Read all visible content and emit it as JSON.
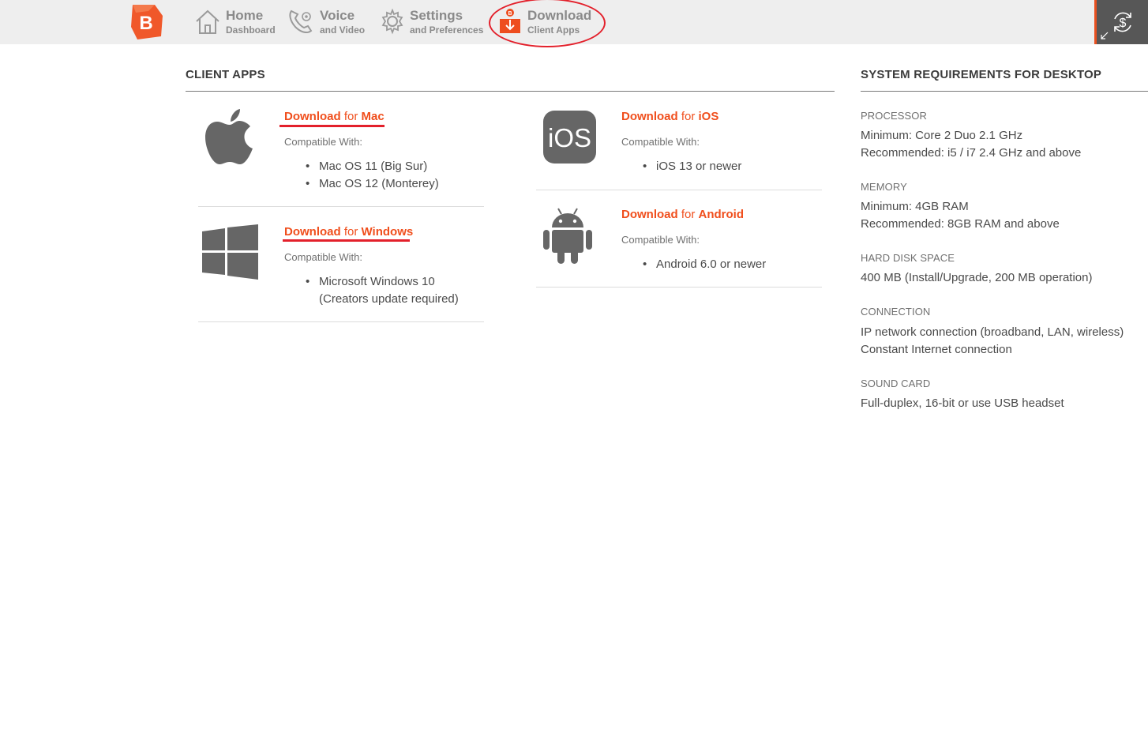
{
  "nav": {
    "home": {
      "title": "Home",
      "subtitle": "Dashboard"
    },
    "voice": {
      "title": "Voice",
      "subtitle": "and Video"
    },
    "settings": {
      "title": "Settings",
      "subtitle": "and Preferences"
    },
    "download": {
      "title": "Download",
      "subtitle": "Client Apps"
    },
    "logo_letter": "B"
  },
  "client_apps": {
    "title": "CLIENT APPS",
    "mac": {
      "link_prefix": "Download",
      "link_mid": " for ",
      "link_platform": "Mac",
      "compat_label": "Compatible With:",
      "items": [
        "Mac OS 11 (Big Sur)",
        "Mac OS 12 (Monterey)"
      ]
    },
    "windows": {
      "link_prefix": "Download",
      "link_mid": " for ",
      "link_platform": "Windows",
      "compat_label": "Compatible With:",
      "items": [
        "Microsoft Windows 10",
        "(Creators update required)"
      ]
    },
    "ios": {
      "icon_text": "iOS",
      "link_prefix": "Download",
      "link_mid": " for ",
      "link_platform": "iOS",
      "compat_label": "Compatible With:",
      "items": [
        "iOS 13 or newer"
      ]
    },
    "android": {
      "link_prefix": "Download",
      "link_mid": " for ",
      "link_platform": "Android",
      "compat_label": "Compatible With:",
      "items": [
        "Android 6.0 or newer"
      ]
    }
  },
  "requirements": {
    "title": "SYSTEM REQUIREMENTS FOR DESKTOP",
    "processor": {
      "label": "PROCESSOR",
      "lines": [
        "Minimum: Core 2 Duo 2.1 GHz",
        "Recommended: i5 / i7 2.4 GHz and above"
      ]
    },
    "memory": {
      "label": "MEMORY",
      "lines": [
        "Minimum: 4GB RAM",
        "Recommended: 8GB RAM and above"
      ]
    },
    "disk": {
      "label": "HARD DISK SPACE",
      "lines": [
        "400 MB (Install/Upgrade, 200 MB operation)"
      ]
    },
    "connection": {
      "label": "CONNECTION",
      "lines": [
        "IP network connection (broadband, LAN, wireless)",
        "Constant Internet connection"
      ]
    },
    "sound": {
      "label": "SOUND CARD",
      "lines": [
        "Full-duplex, 16-bit or use USB headset"
      ]
    }
  },
  "colors": {
    "accent": "#f04e1c",
    "highlight": "#e3202b",
    "icon_gray": "#666666"
  }
}
